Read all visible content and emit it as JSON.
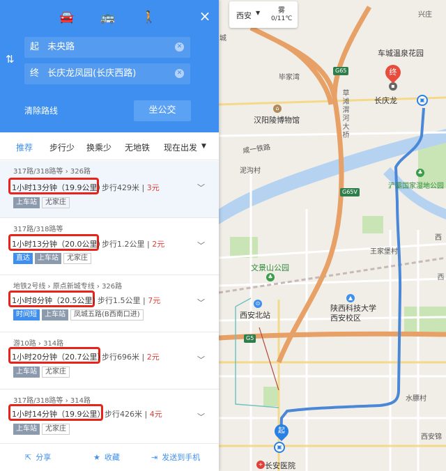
{
  "panel": {
    "modes": [
      {
        "name": "car-icon",
        "glyph": "🚘"
      },
      {
        "name": "bus-icon",
        "glyph": "🚌"
      },
      {
        "name": "walk-icon",
        "glyph": "🚶"
      }
    ],
    "close": "×",
    "swap": "⇅",
    "start": {
      "tag": "起",
      "value": "未央路"
    },
    "end": {
      "tag": "终",
      "value": "长庆龙凤园(长庆西路)"
    },
    "clear_route": "清除路线",
    "bus_button": "坐公交",
    "tabs": [
      "推荐",
      "步行少",
      "换乘少",
      "无地铁",
      "现在出发"
    ],
    "routes": [
      {
        "lines": "317路/318路等 › 326路",
        "time": "1小时13分钟（19.9公里）",
        "walk": "步行429米",
        "price": "3元",
        "tags": [
          "上车站",
          "尤家庄"
        ]
      },
      {
        "lines": "317路/318路等",
        "time": "1小时13分钟（20.0公里）",
        "walk": "步行1.2公里",
        "price": "2元",
        "tags": [
          "直达",
          "上车站",
          "尤家庄"
        ]
      },
      {
        "lines": "地铁2号线 › 原点新城专线 › 326路",
        "time": "1小时8分钟（20.5公里）",
        "walk": "步行1.5公里",
        "price": "7元",
        "tags": [
          "时间短",
          "上车站",
          "凤城五路(B西南口进)"
        ]
      },
      {
        "lines": "游10路 › 314路",
        "time": "1小时20分钟（20.7公里）",
        "walk": "步行696米",
        "price": "2元",
        "tags": [
          "上车站",
          "尤家庄"
        ]
      },
      {
        "lines": "317路/318路等 › 314路",
        "time": "1小时14分钟（19.9公里）",
        "walk": "步行426米",
        "price": "4元",
        "tags": [
          "上车站",
          "尤家庄"
        ]
      }
    ],
    "footer": [
      {
        "icon": "share-icon",
        "glyph": "⇱",
        "label": "分享"
      },
      {
        "icon": "star-icon",
        "glyph": "★",
        "label": "收藏"
      },
      {
        "icon": "send-icon",
        "glyph": "⇥",
        "label": "发送到手机"
      }
    ]
  },
  "weather": {
    "city": "西安",
    "caret": "▼",
    "condition": "雾",
    "temp": "0/11℃"
  },
  "map": {
    "labels": {
      "xingcheng": "兴庄",
      "cheng": "城",
      "chechengwenquan": "车城温泉花园",
      "bijiawan": "毕家湾",
      "changqinglong": "长庆龙",
      "hanlingmuseum": "汉阳陵博物馆",
      "caotan": "草滩渭河大桥",
      "weiyi": "咸一铁路",
      "hongcun": "泥沟村",
      "wetland": "浐灞国家湿地公园",
      "xiguan": "西",
      "wangjiabao": "王家堡村",
      "wenjingshan": "文景山公园",
      "xianbeizhan": "西安北站",
      "sxkj": "陕西科技大学西安校区",
      "xida": "西",
      "shuiliecun": "水膘村",
      "xianjin": "西安锦",
      "changanhospital": "长安医院",
      "end_mark": "终",
      "start_mark": "起"
    },
    "highways": [
      "G65",
      "G65Ⅴ",
      "G5"
    ],
    "colors": {
      "route": "#4a87d6",
      "highway": "#e7a066",
      "water": "#b5d3f0",
      "green": "#c9e5b6"
    }
  },
  "ui_colors": {
    "primary": "#3e8ff0",
    "highlight": "#e8231a",
    "price": "#e0403a"
  }
}
